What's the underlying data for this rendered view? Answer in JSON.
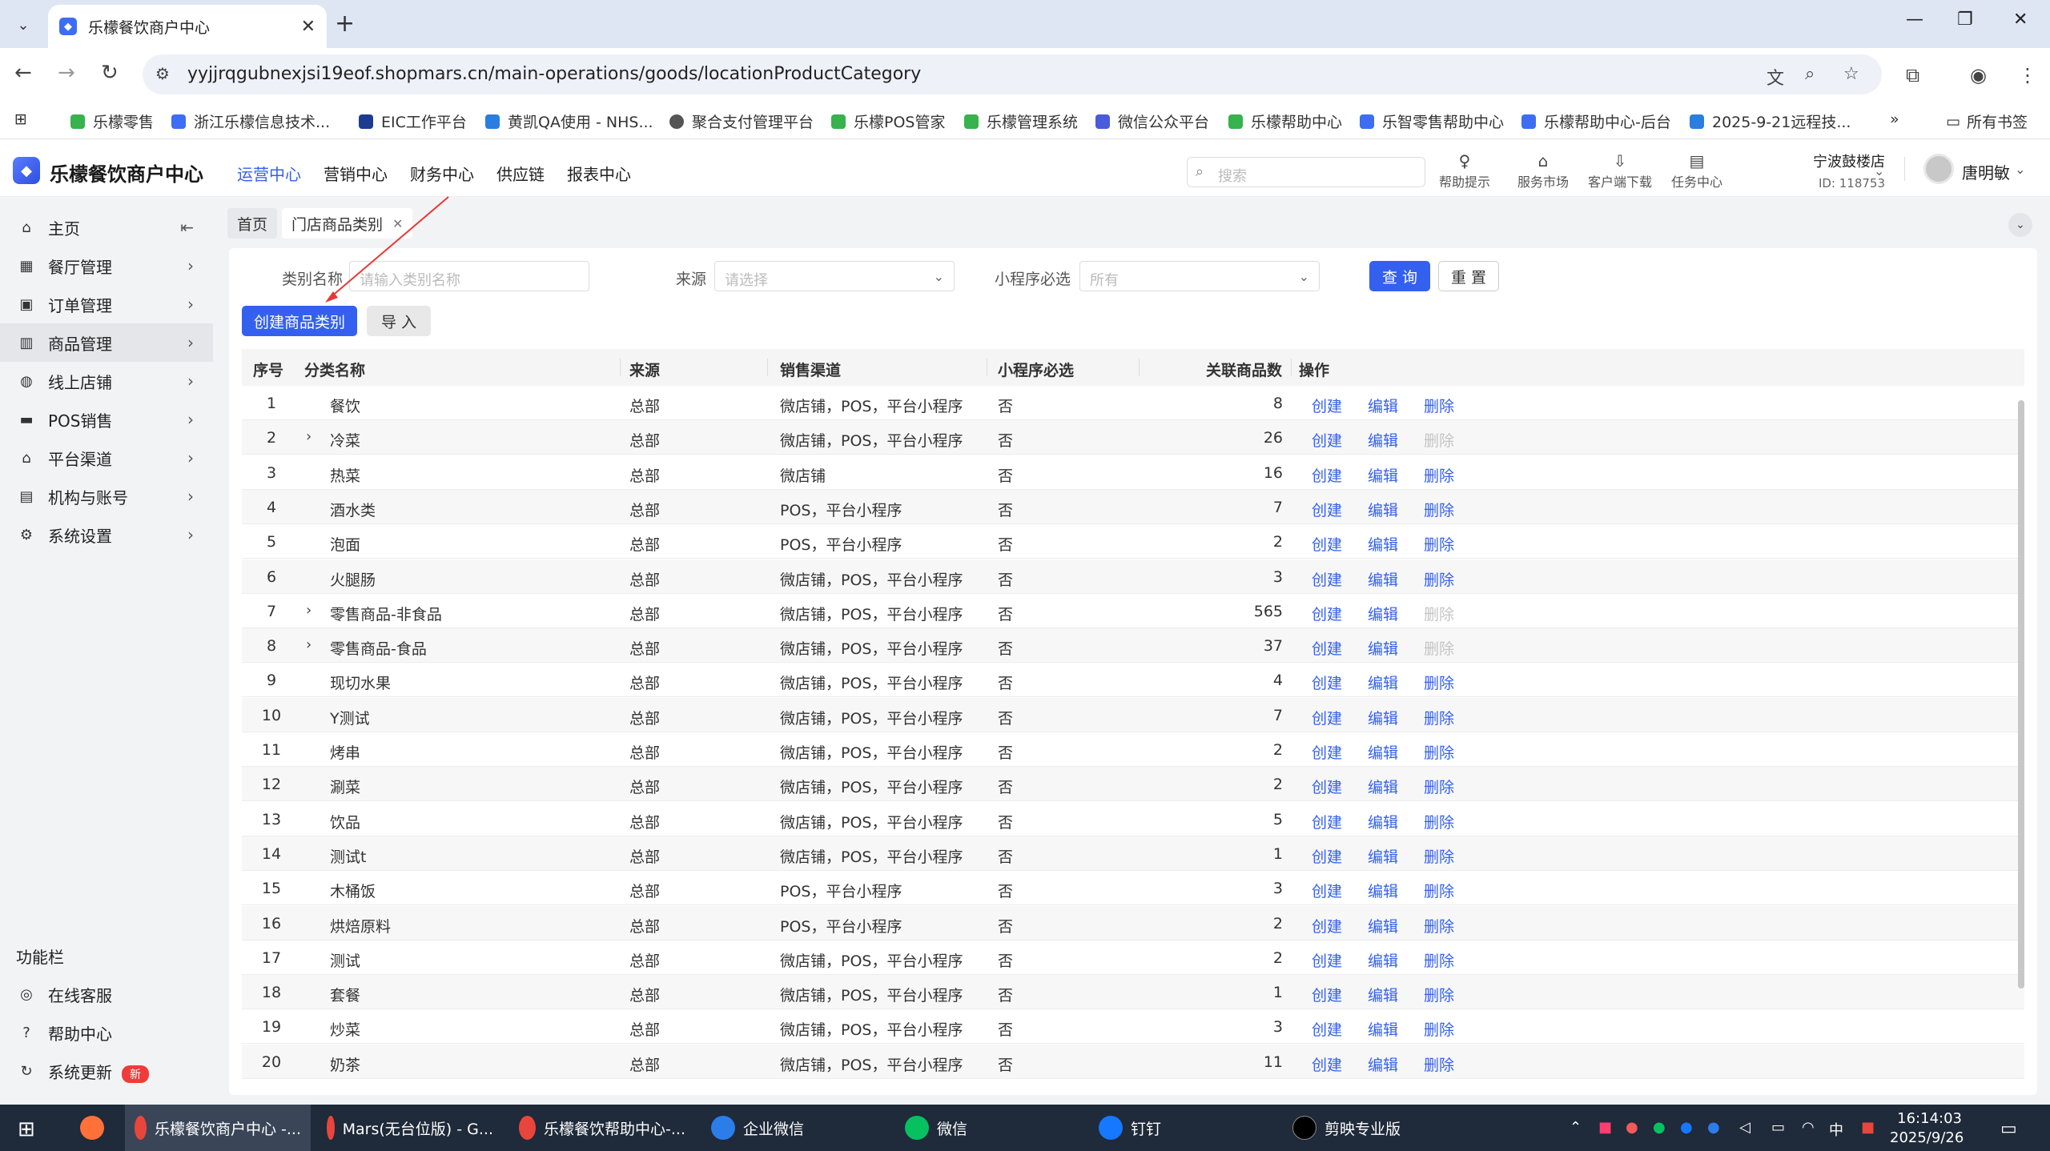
{
  "browser": {
    "tab_title": "乐檬餐饮商户中心",
    "url": "yyjjrqgubnexjsi19eof.shopmars.cn/main-operations/goods/locationProductCategory",
    "bookmarks": [
      "乐檬零售",
      "浙江乐檬信息技术...",
      "EIC工作平台",
      "黄凯QA使用 - NHS...",
      "聚合支付管理平台",
      "乐檬POS管家",
      "乐檬管理系统",
      "微信公众平台",
      "乐檬帮助中心",
      "乐智零售帮助中心",
      "乐檬帮助中心-后台",
      "2025-9-21远程技..."
    ],
    "all_bookmarks": "所有书签"
  },
  "header": {
    "logo_text": "乐檬餐饮商户中心",
    "nav": [
      "运营中心",
      "营销中心",
      "财务中心",
      "供应链",
      "报表中心"
    ],
    "search_placeholder": "搜索",
    "tools": [
      "帮助提示",
      "服务市场",
      "客户端下载",
      "任务中心"
    ],
    "store_name": "宁波鼓楼店",
    "store_id": "ID: 118753",
    "user_name": "唐明敏"
  },
  "sidebar": {
    "items": [
      {
        "label": "主页",
        "icon": "home-icon"
      },
      {
        "label": "餐厅管理",
        "icon": "restaurant-icon"
      },
      {
        "label": "订单管理",
        "icon": "order-icon"
      },
      {
        "label": "商品管理",
        "icon": "goods-icon"
      },
      {
        "label": "线上店铺",
        "icon": "globe-icon"
      },
      {
        "label": "POS销售",
        "icon": "pos-icon"
      },
      {
        "label": "平台渠道",
        "icon": "bank-icon"
      },
      {
        "label": "机构与账号",
        "icon": "account-icon"
      },
      {
        "label": "系统设置",
        "icon": "gear-icon"
      }
    ],
    "section_title": "功能栏",
    "tools": [
      {
        "label": "在线客服",
        "icon": "service-icon"
      },
      {
        "label": "帮助中心",
        "icon": "help-icon"
      },
      {
        "label": "系统更新",
        "icon": "update-icon",
        "badge": "新"
      }
    ]
  },
  "tags": [
    "首页",
    "门店商品类别"
  ],
  "filters": {
    "name_label": "类别名称",
    "name_placeholder": "请输入类别名称",
    "source_label": "来源",
    "source_placeholder": "请选择",
    "mini_label": "小程序必选",
    "mini_value": "所有",
    "query_btn": "查 询",
    "reset_btn": "重 置"
  },
  "actions": {
    "create_btn": "创建商品类别",
    "import_btn": "导 入"
  },
  "table": {
    "headers": [
      "序号",
      "分类名称",
      "来源",
      "销售渠道",
      "小程序必选",
      "关联商品数",
      "操作"
    ],
    "op_labels": [
      "创建",
      "编辑",
      "删除"
    ],
    "rows": [
      {
        "no": "1",
        "name": "餐饮",
        "source": "总部",
        "channel": "微店铺，POS，平台小程序",
        "mini": "否",
        "count": "8",
        "expandable": false,
        "del_disabled": false
      },
      {
        "no": "2",
        "name": "冷菜",
        "source": "总部",
        "channel": "微店铺，POS，平台小程序",
        "mini": "否",
        "count": "26",
        "expandable": true,
        "del_disabled": true
      },
      {
        "no": "3",
        "name": "热菜",
        "source": "总部",
        "channel": "微店铺",
        "mini": "否",
        "count": "16",
        "expandable": false,
        "del_disabled": false
      },
      {
        "no": "4",
        "name": "酒水类",
        "source": "总部",
        "channel": "POS，平台小程序",
        "mini": "否",
        "count": "7",
        "expandable": false,
        "del_disabled": false
      },
      {
        "no": "5",
        "name": "泡面",
        "source": "总部",
        "channel": "POS，平台小程序",
        "mini": "否",
        "count": "2",
        "expandable": false,
        "del_disabled": false
      },
      {
        "no": "6",
        "name": "火腿肠",
        "source": "总部",
        "channel": "微店铺，POS，平台小程序",
        "mini": "否",
        "count": "3",
        "expandable": false,
        "del_disabled": false
      },
      {
        "no": "7",
        "name": "零售商品-非食品",
        "source": "总部",
        "channel": "微店铺，POS，平台小程序",
        "mini": "否",
        "count": "565",
        "expandable": true,
        "del_disabled": true
      },
      {
        "no": "8",
        "name": "零售商品-食品",
        "source": "总部",
        "channel": "微店铺，POS，平台小程序",
        "mini": "否",
        "count": "37",
        "expandable": true,
        "del_disabled": true
      },
      {
        "no": "9",
        "name": "现切水果",
        "source": "总部",
        "channel": "微店铺，POS，平台小程序",
        "mini": "否",
        "count": "4",
        "expandable": false,
        "del_disabled": false
      },
      {
        "no": "10",
        "name": "Y测试",
        "source": "总部",
        "channel": "微店铺，POS，平台小程序",
        "mini": "否",
        "count": "7",
        "expandable": false,
        "del_disabled": false
      },
      {
        "no": "11",
        "name": "烤串",
        "source": "总部",
        "channel": "微店铺，POS，平台小程序",
        "mini": "否",
        "count": "2",
        "expandable": false,
        "del_disabled": false
      },
      {
        "no": "12",
        "name": "涮菜",
        "source": "总部",
        "channel": "微店铺，POS，平台小程序",
        "mini": "否",
        "count": "2",
        "expandable": false,
        "del_disabled": false
      },
      {
        "no": "13",
        "name": "饮品",
        "source": "总部",
        "channel": "微店铺，POS，平台小程序",
        "mini": "否",
        "count": "5",
        "expandable": false,
        "del_disabled": false
      },
      {
        "no": "14",
        "name": "测试t",
        "source": "总部",
        "channel": "微店铺，POS，平台小程序",
        "mini": "否",
        "count": "1",
        "expandable": false,
        "del_disabled": false
      },
      {
        "no": "15",
        "name": "木桶饭",
        "source": "总部",
        "channel": "POS，平台小程序",
        "mini": "否",
        "count": "3",
        "expandable": false,
        "del_disabled": false
      },
      {
        "no": "16",
        "name": "烘焙原料",
        "source": "总部",
        "channel": "POS，平台小程序",
        "mini": "否",
        "count": "2",
        "expandable": false,
        "del_disabled": false
      },
      {
        "no": "17",
        "name": "测试",
        "source": "总部",
        "channel": "微店铺，POS，平台小程序",
        "mini": "否",
        "count": "2",
        "expandable": false,
        "del_disabled": false
      },
      {
        "no": "18",
        "name": "套餐",
        "source": "总部",
        "channel": "微店铺，POS，平台小程序",
        "mini": "否",
        "count": "1",
        "expandable": false,
        "del_disabled": false
      },
      {
        "no": "19",
        "name": "炒菜",
        "source": "总部",
        "channel": "微店铺，POS，平台小程序",
        "mini": "否",
        "count": "3",
        "expandable": false,
        "del_disabled": false
      },
      {
        "no": "20",
        "name": "奶茶",
        "source": "总部",
        "channel": "微店铺，POS，平台小程序",
        "mini": "否",
        "count": "11",
        "expandable": false,
        "del_disabled": false
      }
    ]
  },
  "taskbar": {
    "apps": [
      "乐檬餐饮商户中心 -...",
      "Mars(无台位版) - G...",
      "乐檬餐饮帮助中心-...",
      "企业微信",
      "微信",
      "钉钉",
      "剪映专业版"
    ],
    "tray_lang": "中",
    "time": "16:14:03",
    "date": "2025/9/26"
  },
  "colors": {
    "accent": "#3460f0",
    "taskbar": "#1f2a3a",
    "annotation": "#e53935"
  }
}
